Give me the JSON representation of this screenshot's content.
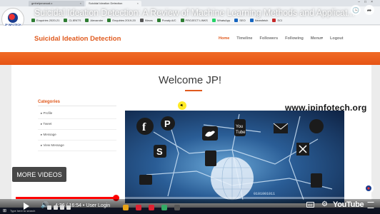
{
  "browser": {
    "tabs": [
      {
        "label": "gmhelpmanual.c",
        "active": false
      },
      {
        "label": "Suicidal Ideation Detection",
        "active": true
      }
    ],
    "bookmarks": [
      {
        "label": "Enquiries 2020-21",
        "color": "#2e7d32"
      },
      {
        "label": "CLIENTS",
        "color": "#2e7d32"
      },
      {
        "label": "Alexander",
        "color": "#2e7d32"
      },
      {
        "label": "Enquiries 2019-20",
        "color": "#2e7d32"
      },
      {
        "label": "iNews",
        "color": "#555555"
      },
      {
        "label": "Ponaly A/C",
        "color": "#2e7d32"
      },
      {
        "label": "PROJECT LINKS",
        "color": "#2e7d32"
      },
      {
        "label": "WhatsApp",
        "color": "#25d366"
      },
      {
        "label": "SEO",
        "color": "#1565c0"
      },
      {
        "label": "Newsfetch",
        "color": "#1565c0"
      },
      {
        "label": "SCI",
        "color": "#c62828"
      }
    ]
  },
  "video": {
    "title": "Suicidal Ideation Detection: A Review of Machine Learning Methods and Applicat...",
    "channel_logo_text": "JP INFOTECH",
    "more_videos": "MORE VIDEOS",
    "time": "4:36 / 16:54 • User Login",
    "progress": 0.28,
    "cc": "CC",
    "brand": "YouTube"
  },
  "site": {
    "brand": "Suicidal Ideation Detection",
    "nav": [
      {
        "label": "Home",
        "active": true
      },
      {
        "label": "Timeline",
        "active": false
      },
      {
        "label": "Followers",
        "active": false
      },
      {
        "label": "Following",
        "active": false
      },
      {
        "label": "Menu▾",
        "active": false
      },
      {
        "label": "Logout",
        "active": false
      }
    ],
    "welcome": "Welcome JP!",
    "categories_title": "Categories",
    "categories": [
      "▸ Profile",
      "▸ Tweet",
      "▸ Message",
      "▸ View Message"
    ],
    "watermark": "www.jpinfotech.org"
  },
  "taskbar": {
    "search_placeholder": "Type here to search"
  },
  "colors": {
    "accent": "#e05a1e",
    "band": "#f06a25",
    "progress": "#ff0000"
  },
  "icons": [
    "windows-icon",
    "play-icon",
    "volume-icon",
    "settings-icon",
    "fullscreen-icon",
    "subtitles-icon"
  ]
}
